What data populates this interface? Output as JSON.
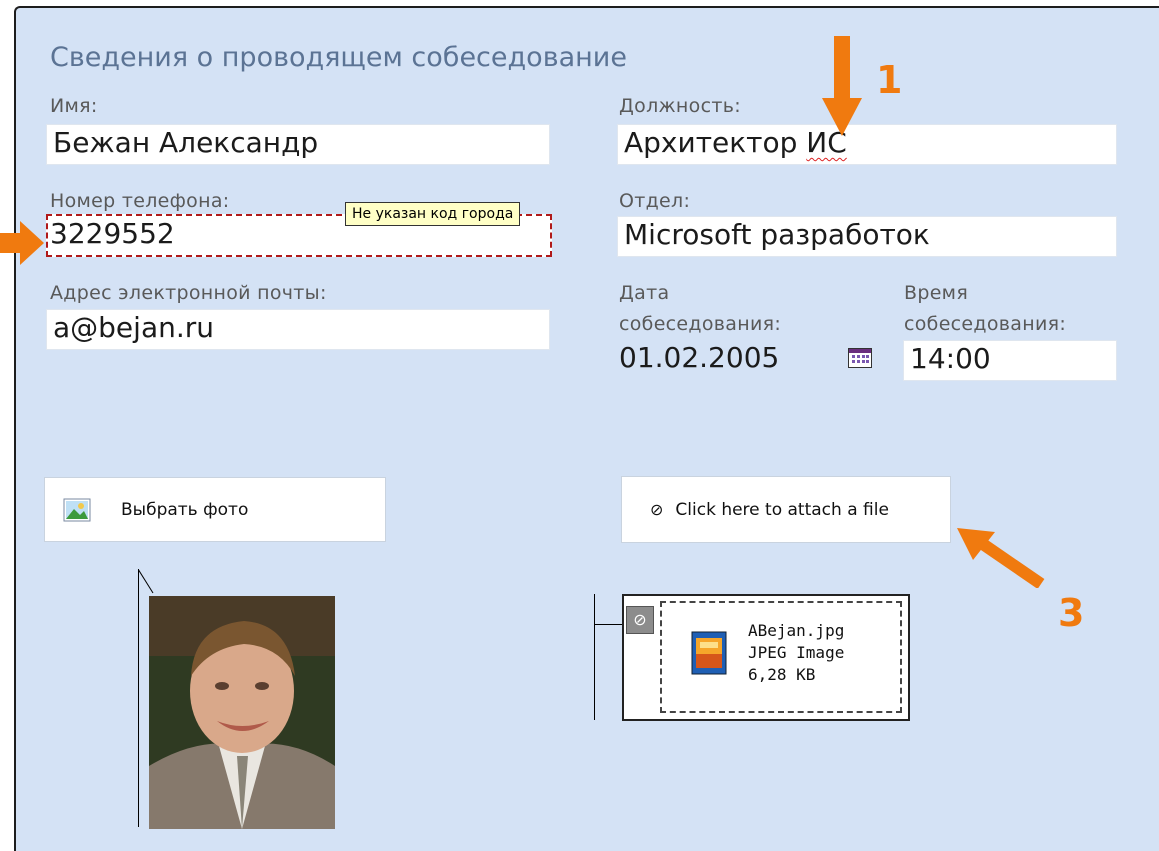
{
  "form": {
    "title": "Сведения о проводящем собеседование",
    "name": {
      "label": "Имя:",
      "value": "Бежан Александр"
    },
    "position": {
      "label": "Должность:",
      "value_main": "Архитектор ",
      "value_underlined": "ИС"
    },
    "phone": {
      "label": "Номер телефона:",
      "value": "3229552",
      "tooltip": "Не указан код города"
    },
    "department": {
      "label": "Отдел:",
      "value": "Microsoft разработок"
    },
    "email": {
      "label": "Адрес электронной почты:",
      "value": "a@bejan.ru"
    },
    "date": {
      "label_line1": "Дата",
      "label_line2": "собеседования:",
      "value": "01.02.2005"
    },
    "time": {
      "label_line1": "Время",
      "label_line2": "собеседования:",
      "value": "14:00"
    },
    "photo_button": {
      "label": "Выбрать фото"
    },
    "attach_button": {
      "label": "Click here to attach a file"
    },
    "attachment": {
      "file_name": "ABejan.jpg",
      "file_type": "JPEG Image",
      "file_size": "6,28 KB"
    }
  },
  "annotations": {
    "marker_1": "1",
    "marker_3": "3"
  },
  "colors": {
    "background": "#d4e2f5",
    "title": "#5b7394",
    "error_border": "#b01919",
    "tooltip_bg": "#ffffc6",
    "annotation_orange": "#f07a0f"
  },
  "icons": {
    "photo_button": "picture-icon",
    "attach_button": "paperclip-icon",
    "calendar": "calendar-icon",
    "file": "jpeg-file-icon"
  }
}
